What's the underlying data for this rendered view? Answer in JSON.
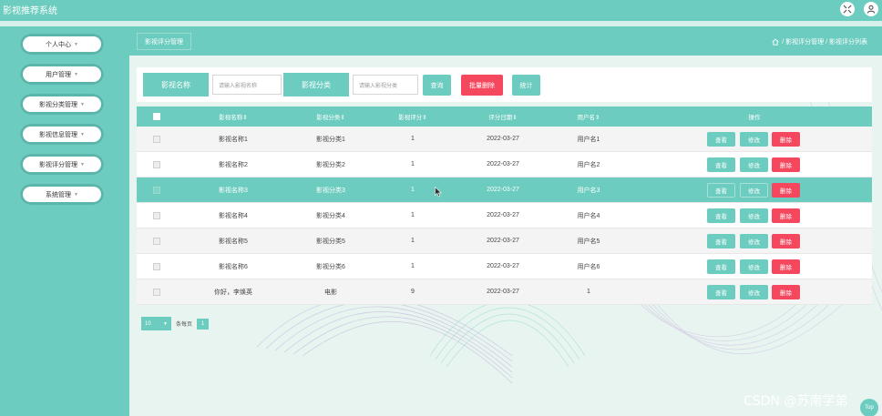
{
  "app": {
    "title": "影视推荐系统"
  },
  "header_icons": {
    "fullscreen": "fullscreen-icon",
    "user": "user-icon"
  },
  "sidebar": {
    "items": [
      {
        "label": "个人中心"
      },
      {
        "label": "用户管理"
      },
      {
        "label": "影视分类管理"
      },
      {
        "label": "影视信息管理"
      },
      {
        "label": "影视评分管理"
      },
      {
        "label": "系统管理"
      }
    ]
  },
  "page": {
    "tag": "影视评分管理",
    "breadcrumb": "/ 影视评分管理 / 影视评分列表"
  },
  "search": {
    "name_label": "影视名称",
    "name_placeholder": "请输入影视名称",
    "category_label": "影视分类",
    "category_placeholder": "请输入影视分类",
    "query_btn": "查询",
    "batch_delete_btn": "批量删除",
    "stats_btn": "统计"
  },
  "table": {
    "headers": [
      "影视名称⇕",
      "影视分类⇕",
      "影视评分⇕",
      "评分日期⇕",
      "用户名⇕",
      "操作"
    ],
    "rows": [
      [
        "影视名称1",
        "影视分类1",
        "1",
        "2022-03-27",
        "用户名1"
      ],
      [
        "影视名称2",
        "影视分类2",
        "1",
        "2022-03-27",
        "用户名2"
      ],
      [
        "影视名称3",
        "影视分类3",
        "1",
        "2022-03-27",
        "用户名3"
      ],
      [
        "影视名称4",
        "影视分类4",
        "1",
        "2022-03-27",
        "用户名4"
      ],
      [
        "影视名称5",
        "影视分类5",
        "1",
        "2022-03-27",
        "用户名5"
      ],
      [
        "影视名称6",
        "影视分类6",
        "1",
        "2022-03-27",
        "用户名6"
      ],
      [
        "你好，李焕英",
        "电影",
        "9",
        "2022-03-27",
        "1"
      ]
    ],
    "highlighted_row": 2,
    "actions": {
      "view": "查看",
      "edit": "修改",
      "delete": "删除"
    }
  },
  "pager": {
    "page_size": "10",
    "per_page_label": "条每页",
    "current_page": "1"
  },
  "watermark": "CSDN @苏南学弟",
  "top_button": "Top",
  "colors": {
    "accent": "#6cccbf",
    "danger": "#f5485f"
  }
}
